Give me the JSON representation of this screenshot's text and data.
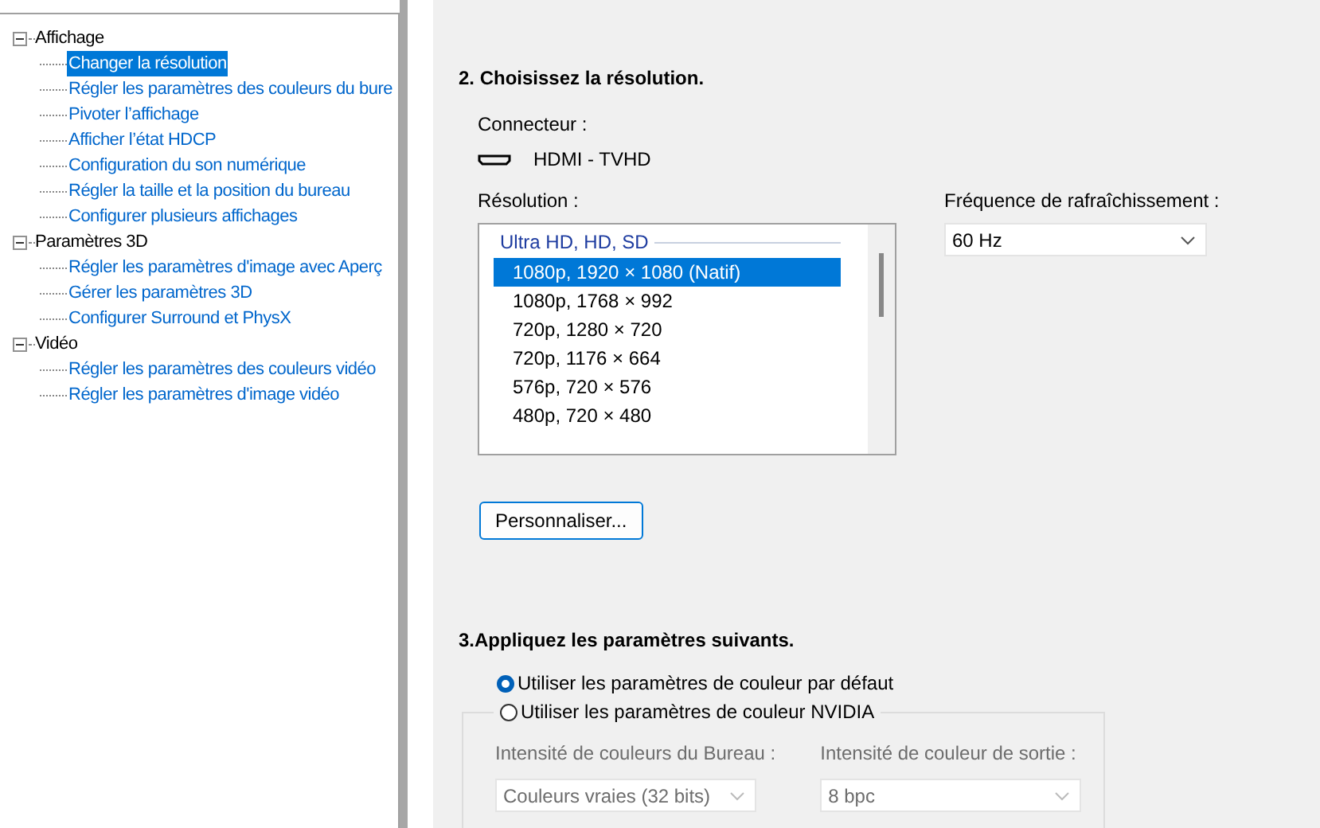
{
  "tree": [
    {
      "label": "Affichage",
      "expanded": true,
      "children": [
        {
          "label": "Changer la résolution",
          "selected": true
        },
        {
          "label": "Régler les paramètres des couleurs du bure",
          "selected": false
        },
        {
          "label": "Pivoter l’affichage",
          "selected": false
        },
        {
          "label": "Afficher l’état HDCP",
          "selected": false
        },
        {
          "label": "Configuration du son numérique",
          "selected": false
        },
        {
          "label": "Régler la taille et la position du bureau",
          "selected": false
        },
        {
          "label": "Configurer plusieurs affichages",
          "selected": false
        }
      ]
    },
    {
      "label": "Paramètres 3D",
      "expanded": true,
      "children": [
        {
          "label": "Régler les paramètres d'image avec Aperç",
          "selected": false
        },
        {
          "label": "Gérer les paramètres 3D",
          "selected": false
        },
        {
          "label": "Configurer Surround et PhysX",
          "selected": false
        }
      ]
    },
    {
      "label": "Vidéo",
      "expanded": true,
      "children": [
        {
          "label": "Régler les paramètres des couleurs vidéo",
          "selected": false
        },
        {
          "label": "Régler les paramètres d'image vidéo",
          "selected": false
        }
      ]
    }
  ],
  "resolution_section": {
    "heading": "2. Choisissez la résolution.",
    "connector_label": "Connecteur :",
    "connector": "HDMI - TVHD",
    "resolution_label": "Résolution :",
    "resolution_groups": [
      {
        "label": "Ultra HD, HD, SD",
        "items": [
          {
            "label": "1080p, 1920 × 1080 (Natif)",
            "selected": true
          },
          {
            "label": "1080p, 1768 × 992",
            "selected": false
          },
          {
            "label": "720p, 1280 × 720",
            "selected": false
          },
          {
            "label": "720p, 1176 × 664",
            "selected": false
          },
          {
            "label": "576p, 720 × 576",
            "selected": false
          },
          {
            "label": "480p, 720 × 480",
            "selected": false
          }
        ]
      }
    ],
    "refresh_label": "Fréquence de rafraîchissement :",
    "refresh_value": "60 Hz",
    "custom_button": "Personnaliser..."
  },
  "apply_section": {
    "heading": "3.Appliquez les paramètres suivants.",
    "options": [
      {
        "label": "Utiliser les paramètres de couleur par défaut",
        "selected": true
      },
      {
        "label": "Utiliser les paramètres de couleur NVIDIA",
        "selected": false
      }
    ],
    "nvidia_group": {
      "disabled": true,
      "desktop_depth_label": "Intensité de couleurs du Bureau :",
      "desktop_depth_value": "Couleurs vraies (32 bits)",
      "output_depth_label": "Intensité de couleur de sortie :",
      "output_depth_value": "8 bpc"
    }
  }
}
